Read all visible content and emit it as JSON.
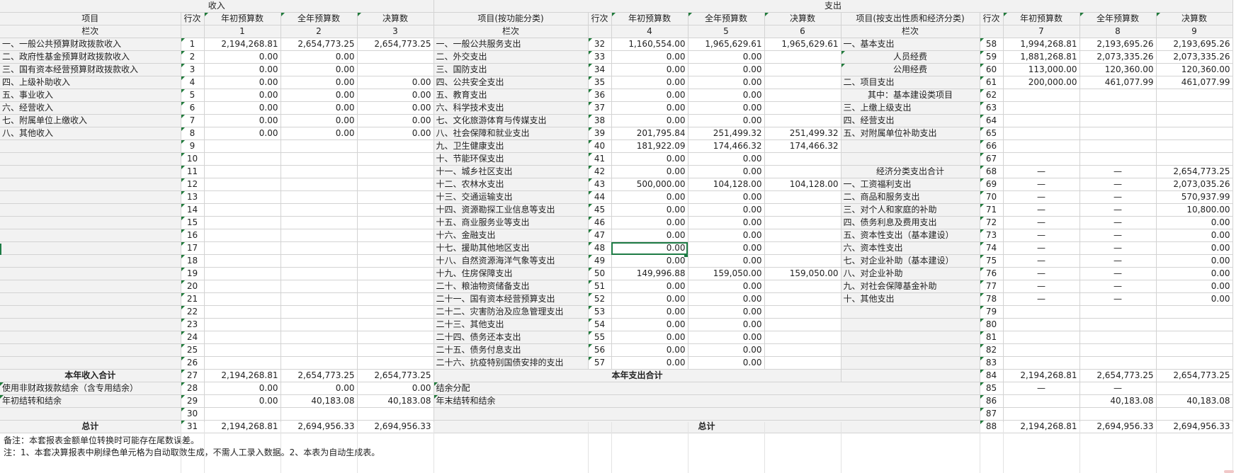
{
  "headers": {
    "income": "收入",
    "expense": "支出",
    "item": "项目",
    "row_no": "行次",
    "col_label": "栏次",
    "budget_initial": "年初预算数",
    "budget_full": "全年预算数",
    "final": "决算数",
    "item_func": "项目(按功能分类)",
    "item_econ": "项目(按支出性质和经济分类)",
    "col_nums": [
      "1",
      "2",
      "3",
      "4",
      "5",
      "6",
      "7",
      "8",
      "9"
    ]
  },
  "rows": [
    {
      "ia": "一、一般公共预算财政拨款收入",
      "ib": "1",
      "ic": "2,194,268.81",
      "id": "2,654,773.25",
      "ie": "2,654,773.25",
      "fa": "一、一般公共服务支出",
      "fb": "32",
      "fc": "1,160,554.00",
      "fd": "1,965,629.61",
      "fe": "1,965,629.61",
      "ea": "一、基本支出",
      "eb": "58",
      "ec": "1,994,268.81",
      "ed": "2,193,695.26",
      "ee": "2,193,695.26"
    },
    {
      "ia": "二、政府性基金预算财政拨款收入",
      "ib": "2",
      "ic": "0.00",
      "id": "0.00",
      "ie": "",
      "fa": "二、外交支出",
      "fb": "33",
      "fc": "0.00",
      "fd": "0.00",
      "fe": "",
      "ea": "人员经费",
      "eb": "59",
      "ec": "1,881,268.81",
      "ed": "2,073,335.26",
      "ee": "2,073,335.26"
    },
    {
      "ia": "三、国有资本经营预算财政拨款收入",
      "ib": "3",
      "ic": "0.00",
      "id": "0.00",
      "ie": "",
      "fa": "三、国防支出",
      "fb": "34",
      "fc": "0.00",
      "fd": "0.00",
      "fe": "",
      "ea": "公用经费",
      "eb": "60",
      "ec": "113,000.00",
      "ed": "120,360.00",
      "ee": "120,360.00"
    },
    {
      "ia": "四、上级补助收入",
      "ib": "4",
      "ic": "0.00",
      "id": "0.00",
      "ie": "0.00",
      "fa": "四、公共安全支出",
      "fb": "35",
      "fc": "0.00",
      "fd": "0.00",
      "fe": "",
      "ea": "二、项目支出",
      "eb": "61",
      "ec": "200,000.00",
      "ed": "461,077.99",
      "ee": "461,077.99"
    },
    {
      "ia": "五、事业收入",
      "ib": "5",
      "ic": "0.00",
      "id": "0.00",
      "ie": "0.00",
      "fa": "五、教育支出",
      "fb": "36",
      "fc": "0.00",
      "fd": "0.00",
      "fe": "",
      "ea": "其中：基本建设类项目",
      "eb": "62",
      "ec": "",
      "ed": "",
      "ee": ""
    },
    {
      "ia": "六、经营收入",
      "ib": "6",
      "ic": "0.00",
      "id": "0.00",
      "ie": "0.00",
      "fa": "六、科学技术支出",
      "fb": "37",
      "fc": "0.00",
      "fd": "0.00",
      "fe": "",
      "ea": "三、上缴上级支出",
      "eb": "63",
      "ec": "",
      "ed": "",
      "ee": ""
    },
    {
      "ia": "七、附属单位上缴收入",
      "ib": "7",
      "ic": "0.00",
      "id": "0.00",
      "ie": "0.00",
      "fa": "七、文化旅游体育与传媒支出",
      "fb": "38",
      "fc": "0.00",
      "fd": "0.00",
      "fe": "",
      "ea": "四、经营支出",
      "eb": "64",
      "ec": "",
      "ed": "",
      "ee": ""
    },
    {
      "ia": "八、其他收入",
      "ib": "8",
      "ic": "0.00",
      "id": "0.00",
      "ie": "0.00",
      "fa": "八、社会保障和就业支出",
      "fb": "39",
      "fc": "201,795.84",
      "fd": "251,499.32",
      "fe": "251,499.32",
      "ea": "五、对附属单位补助支出",
      "eb": "65",
      "ec": "",
      "ed": "",
      "ee": ""
    },
    {
      "ia": "",
      "ib": "9",
      "ic": "",
      "id": "",
      "ie": "",
      "fa": "九、卫生健康支出",
      "fb": "40",
      "fc": "181,922.09",
      "fd": "174,466.32",
      "fe": "174,466.32",
      "ea": "",
      "eb": "66",
      "ec": "",
      "ed": "",
      "ee": ""
    },
    {
      "ia": "",
      "ib": "10",
      "ic": "",
      "id": "",
      "ie": "",
      "fa": "十、节能环保支出",
      "fb": "41",
      "fc": "0.00",
      "fd": "0.00",
      "fe": "",
      "ea": "",
      "eb": "67",
      "ec": "",
      "ed": "",
      "ee": ""
    },
    {
      "ia": "",
      "ib": "11",
      "ic": "",
      "id": "",
      "ie": "",
      "fa": "十一、城乡社区支出",
      "fb": "42",
      "fc": "0.00",
      "fd": "0.00",
      "fe": "",
      "ea": "经济分类支出合计",
      "eb": "68",
      "ec": "—",
      "ed": "—",
      "ee": "2,654,773.25"
    },
    {
      "ia": "",
      "ib": "12",
      "ic": "",
      "id": "",
      "ie": "",
      "fa": "十二、农林水支出",
      "fb": "43",
      "fc": "500,000.00",
      "fd": "104,128.00",
      "fe": "104,128.00",
      "ea": "一、工资福利支出",
      "eb": "69",
      "ec": "—",
      "ed": "—",
      "ee": "2,073,035.26"
    },
    {
      "ia": "",
      "ib": "13",
      "ic": "",
      "id": "",
      "ie": "",
      "fa": "十三、交通运输支出",
      "fb": "44",
      "fc": "0.00",
      "fd": "0.00",
      "fe": "",
      "ea": "二、商品和服务支出",
      "eb": "70",
      "ec": "—",
      "ed": "—",
      "ee": "570,937.99"
    },
    {
      "ia": "",
      "ib": "14",
      "ic": "",
      "id": "",
      "ie": "",
      "fa": "十四、资源勘探工业信息等支出",
      "fb": "45",
      "fc": "0.00",
      "fd": "0.00",
      "fe": "",
      "ea": "三、对个人和家庭的补助",
      "eb": "71",
      "ec": "—",
      "ed": "—",
      "ee": "10,800.00"
    },
    {
      "ia": "",
      "ib": "15",
      "ic": "",
      "id": "",
      "ie": "",
      "fa": "十五、商业服务业等支出",
      "fb": "46",
      "fc": "0.00",
      "fd": "0.00",
      "fe": "",
      "ea": "四、债务利息及费用支出",
      "eb": "72",
      "ec": "—",
      "ed": "—",
      "ee": "0.00"
    },
    {
      "ia": "",
      "ib": "16",
      "ic": "",
      "id": "",
      "ie": "",
      "fa": "十六、金融支出",
      "fb": "47",
      "fc": "0.00",
      "fd": "0.00",
      "fe": "",
      "ea": "五、资本性支出（基本建设）",
      "eb": "73",
      "ec": "—",
      "ed": "—",
      "ee": "0.00"
    },
    {
      "ia": "",
      "ib": "17",
      "ic": "",
      "id": "",
      "ie": "",
      "fa": "十七、援助其他地区支出",
      "fb": "48",
      "fc": "0.00",
      "fd": "0.00",
      "fe": "",
      "ea": "六、资本性支出",
      "eb": "74",
      "ec": "—",
      "ed": "—",
      "ee": "0.00"
    },
    {
      "ia": "",
      "ib": "18",
      "ic": "",
      "id": "",
      "ie": "",
      "fa": "十八、自然资源海洋气象等支出",
      "fb": "49",
      "fc": "0.00",
      "fd": "0.00",
      "fe": "",
      "ea": "七、对企业补助（基本建设）",
      "eb": "75",
      "ec": "—",
      "ed": "—",
      "ee": "0.00"
    },
    {
      "ia": "",
      "ib": "19",
      "ic": "",
      "id": "",
      "ie": "",
      "fa": "十九、住房保障支出",
      "fb": "50",
      "fc": "149,996.88",
      "fd": "159,050.00",
      "fe": "159,050.00",
      "ea": "八、对企业补助",
      "eb": "76",
      "ec": "—",
      "ed": "—",
      "ee": "0.00"
    },
    {
      "ia": "",
      "ib": "20",
      "ic": "",
      "id": "",
      "ie": "",
      "fa": "二十、粮油物资储备支出",
      "fb": "51",
      "fc": "0.00",
      "fd": "0.00",
      "fe": "",
      "ea": "九、对社会保障基金补助",
      "eb": "77",
      "ec": "—",
      "ed": "—",
      "ee": "0.00"
    },
    {
      "ia": "",
      "ib": "21",
      "ic": "",
      "id": "",
      "ie": "",
      "fa": "二十一、国有资本经营预算支出",
      "fb": "52",
      "fc": "0.00",
      "fd": "0.00",
      "fe": "",
      "ea": "十、其他支出",
      "eb": "78",
      "ec": "—",
      "ed": "—",
      "ee": "0.00"
    },
    {
      "ia": "",
      "ib": "22",
      "ic": "",
      "id": "",
      "ie": "",
      "fa": "二十二、灾害防治及应急管理支出",
      "fb": "53",
      "fc": "0.00",
      "fd": "0.00",
      "fe": "",
      "ea": "",
      "eb": "79",
      "ec": "",
      "ed": "",
      "ee": ""
    },
    {
      "ia": "",
      "ib": "23",
      "ic": "",
      "id": "",
      "ie": "",
      "fa": "二十三、其他支出",
      "fb": "54",
      "fc": "0.00",
      "fd": "0.00",
      "fe": "",
      "ea": "",
      "eb": "80",
      "ec": "",
      "ed": "",
      "ee": ""
    },
    {
      "ia": "",
      "ib": "24",
      "ic": "",
      "id": "",
      "ie": "",
      "fa": "二十四、债务还本支出",
      "fb": "55",
      "fc": "0.00",
      "fd": "0.00",
      "fe": "",
      "ea": "",
      "eb": "81",
      "ec": "",
      "ed": "",
      "ee": ""
    },
    {
      "ia": "",
      "ib": "25",
      "ic": "",
      "id": "",
      "ie": "",
      "fa": "二十五、债务付息支出",
      "fb": "56",
      "fc": "0.00",
      "fd": "0.00",
      "fe": "",
      "ea": "",
      "eb": "82",
      "ec": "",
      "ed": "",
      "ee": ""
    },
    {
      "ia": "",
      "ib": "26",
      "ic": "",
      "id": "",
      "ie": "",
      "fa": "二十六、抗疫特别国债安排的支出",
      "fb": "57",
      "fc": "0.00",
      "fd": "0.00",
      "fe": "",
      "ea": "",
      "eb": "83",
      "ec": "",
      "ed": "",
      "ee": ""
    }
  ],
  "bottom": {
    "income_total_label": "本年收入合计",
    "income_total": {
      "no": "27",
      "c": "2,194,268.81",
      "d": "2,654,773.25",
      "e": "2,654,773.25"
    },
    "expense_total_label": "本年支出合计",
    "expense_total": {
      "no": "84",
      "c": "2,194,268.81",
      "d": "2,654,773.25",
      "e": "2,654,773.25"
    },
    "r28": {
      "label": "使用非财政拨款结余（含专用结余）",
      "no": "28",
      "c": "0.00",
      "d": "0.00",
      "e": "0.00",
      "label_r": "结余分配",
      "no_r": "85",
      "c_r": "—",
      "d_r": "—",
      "e_r": ""
    },
    "r29": {
      "label": "年初结转和结余",
      "no": "29",
      "c": "0.00",
      "d": "40,183.08",
      "e": "40,183.08",
      "label_r": "年末结转和结余",
      "no_r": "86",
      "c_r": "",
      "d_r": "40,183.08",
      "e_r": "40,183.08"
    },
    "r30": {
      "no": "30",
      "no_r": "87"
    },
    "total_label": "总计",
    "total": {
      "no": "31",
      "c": "2,194,268.81",
      "d": "2,694,956.33",
      "e": "2,694,956.33"
    },
    "total_r": {
      "no": "88",
      "c": "2,194,268.81",
      "d": "2,694,956.33",
      "e": "2,694,956.33"
    }
  },
  "notes": [
    "备注：本套报表金额单位转换时可能存在尾数误差。",
    "注：1、本套决算报表中刷绿色单元格为自动取数生成，不需人工录入数据。2、本表为自动生成表。"
  ]
}
